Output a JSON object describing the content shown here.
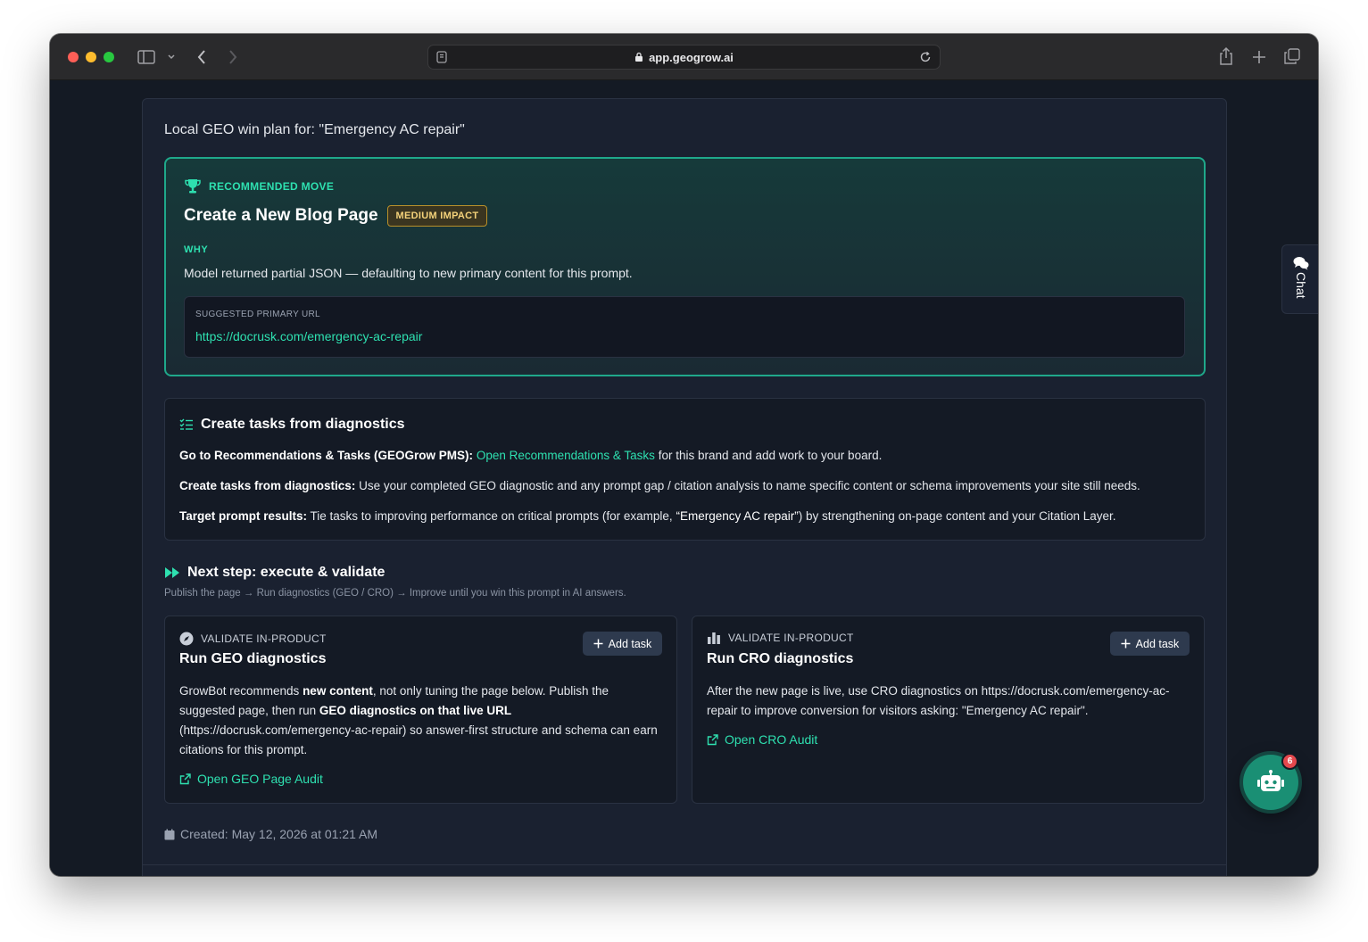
{
  "browser": {
    "url": "app.geogrow.ai"
  },
  "plan": {
    "title": "Local GEO win plan for: \"Emergency AC repair\""
  },
  "recommended": {
    "label": "RECOMMENDED MOVE",
    "title": "Create a New Blog Page",
    "impact": "MEDIUM IMPACT",
    "why_label": "WHY",
    "why_text": "Model returned partial JSON — defaulting to new primary content for this prompt.",
    "url_label": "SUGGESTED PRIMARY URL",
    "url": "https://docrusk.com/emergency-ac-repair"
  },
  "tasks": {
    "title": "Create tasks from diagnostics",
    "line1_bold": "Go to Recommendations & Tasks (GEOGrow PMS):",
    "line1_link": "Open Recommendations & Tasks",
    "line1_rest": "for this brand and add work to your board.",
    "line2_bold": "Create tasks from diagnostics:",
    "line2_rest": "Use your completed GEO diagnostic and any prompt gap / citation analysis to name specific content or schema improvements your site still needs.",
    "line3_bold": "Target prompt results:",
    "line3_rest_a": "Tie tasks to improving performance on critical prompts (for example,",
    "line3_quote": "“Emergency AC repair”",
    "line3_rest_b": ") by strengthening on-page content and your Citation Layer."
  },
  "next": {
    "title": "Next step: execute & validate",
    "subtitle": "Publish the page → Run diagnostics (GEO / CRO) → Improve until you win this prompt in AI answers."
  },
  "geo_card": {
    "label": "VALIDATE IN-PRODUCT",
    "title": "Run GEO diagnostics",
    "add_task": "Add task",
    "body_a": "GrowBot recommends",
    "body_b": "new content",
    "body_c": ", not only tuning the page below. Publish the suggested page, then run",
    "body_d": "GEO diagnostics on that live URL",
    "body_e": "(https://docrusk.com/emergency-ac-repair) so answer-first structure and schema can earn citations for this prompt.",
    "link": "Open GEO Page Audit"
  },
  "cro_card": {
    "label": "VALIDATE IN-PRODUCT",
    "title": "Run CRO diagnostics",
    "add_task": "Add task",
    "body": "After the new page is live, use CRO diagnostics on https://docrusk.com/emergency-ac-repair to improve conversion for visitors asking: \"Emergency AC repair\".",
    "link": "Open CRO Audit"
  },
  "created": "Created: May 12, 2026 at 01:21 AM",
  "chat_tab": "Chat",
  "bot_badge": "6",
  "colors": {
    "accent": "#2ee0b0",
    "impact": "#f4d27a",
    "background": "#141a24"
  }
}
